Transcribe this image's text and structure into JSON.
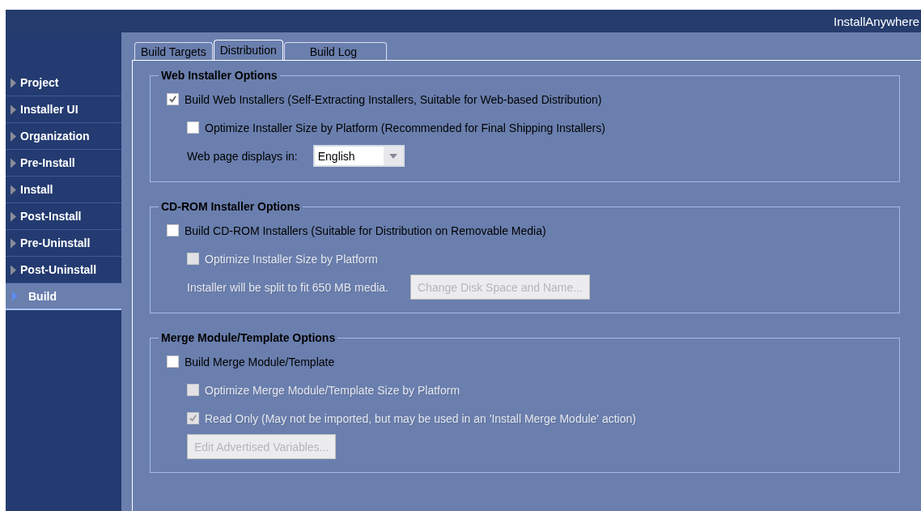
{
  "header": {
    "brand": "InstallAnywhere"
  },
  "sidebar": {
    "items": [
      {
        "label": "Project",
        "selected": false
      },
      {
        "label": "Installer UI",
        "selected": false
      },
      {
        "label": "Organization",
        "selected": false
      },
      {
        "label": "Pre-Install",
        "selected": false
      },
      {
        "label": "Install",
        "selected": false
      },
      {
        "label": "Post-Install",
        "selected": false
      },
      {
        "label": "Pre-Uninstall",
        "selected": false
      },
      {
        "label": "Post-Uninstall",
        "selected": false
      },
      {
        "label": "Build",
        "selected": true
      }
    ]
  },
  "tabs": [
    {
      "label": "Build Targets",
      "selected": false
    },
    {
      "label": "Distribution",
      "selected": true
    },
    {
      "label": "Build Log",
      "selected": false
    }
  ],
  "sections": [
    {
      "title": "Web Installer Options",
      "options": [
        {
          "kind": "checkbox",
          "label": "Build Web Installers (Self-Extracting Installers, Suitable for Web-based Distribution)",
          "checked": true,
          "disabled": false,
          "children": [
            {
              "kind": "checkbox",
              "label": "Optimize Installer Size by Platform (Recommended for Final Shipping Installers)",
              "checked": false,
              "disabled": false
            },
            {
              "kind": "select",
              "label": "Web page displays in:",
              "value": "English",
              "disabled": false
            }
          ]
        }
      ]
    },
    {
      "title": "CD-ROM Installer Options",
      "options": [
        {
          "kind": "checkbox",
          "label": "Build CD-ROM Installers (Suitable for Distribution on Removable Media)",
          "checked": false,
          "disabled": false,
          "children": [
            {
              "kind": "checkbox",
              "label": "Optimize Installer Size by Platform",
              "checked": false,
              "disabled": true
            },
            {
              "kind": "note",
              "label": "Installer will be split to fit 650 MB media.",
              "button": "Change Disk Space and Name...",
              "disabled": true
            }
          ]
        }
      ]
    },
    {
      "title": "Merge Module/Template Options",
      "options": [
        {
          "kind": "checkbox",
          "label": "Build Merge Module/Template",
          "checked": false,
          "disabled": false,
          "children": [
            {
              "kind": "checkbox",
              "label": "Optimize Merge Module/Template Size by Platform",
              "checked": false,
              "disabled": true
            },
            {
              "kind": "checkbox",
              "label": "Read Only (May not be imported, but may be used in an 'Install Merge Module' action)",
              "checked": true,
              "disabled": true
            },
            {
              "kind": "button",
              "button": "Edit Advertised Variables...",
              "disabled": true
            }
          ]
        }
      ]
    }
  ]
}
